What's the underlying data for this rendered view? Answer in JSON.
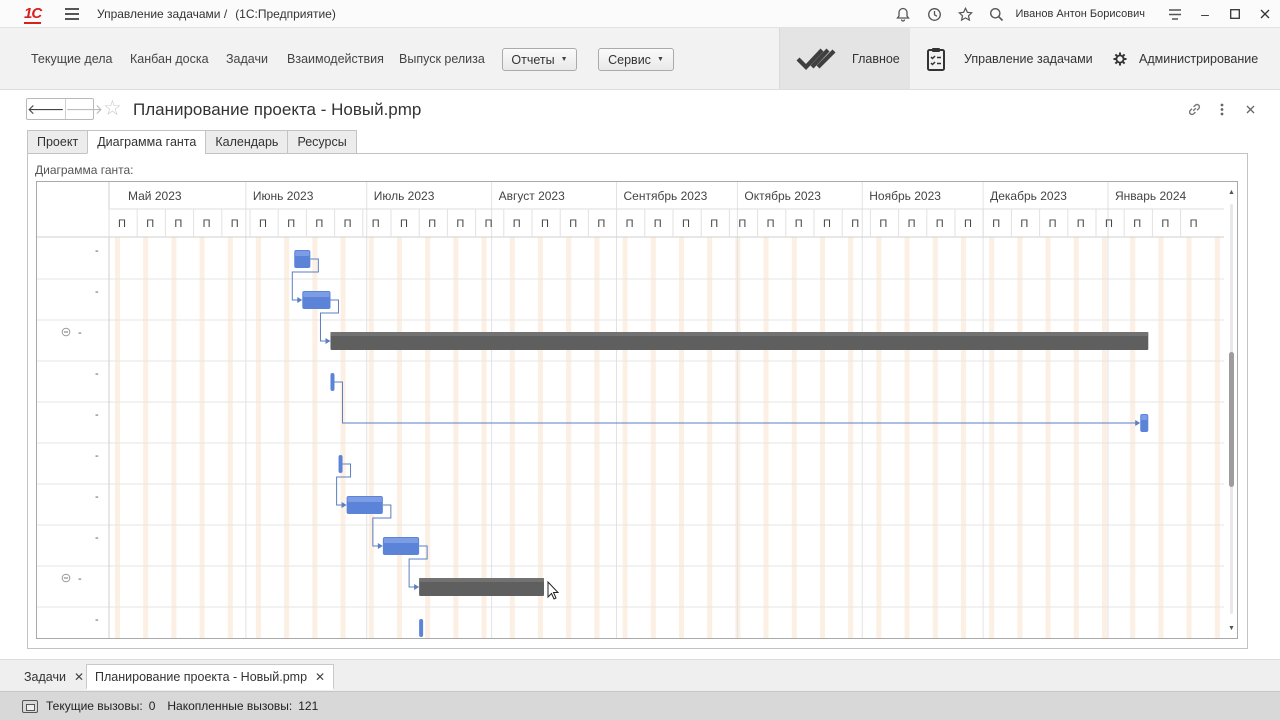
{
  "titlebar": {
    "logo": "1С",
    "app_title": "Управление задачами /",
    "app_platform": "(1С:Предприятие)",
    "user": "Иванов Антон Борисович",
    "icons": [
      "bell-icon",
      "history-icon",
      "star-icon",
      "search-icon",
      "settings-icon",
      "minimize-icon",
      "maximize-icon",
      "close-icon"
    ]
  },
  "nav": {
    "links": [
      "Текущие дела",
      "Канбан доска",
      "Задачи",
      "Взаимодействия",
      "Выпуск релиза"
    ],
    "dropdowns": [
      "Отчеты",
      "Сервис"
    ],
    "sections": [
      "Главное",
      "Управление задачами",
      "Администрирование"
    ]
  },
  "form": {
    "title": "Планирование проекта - Новый.pmp",
    "back": "🡐",
    "forward": "🡒",
    "tools": [
      "link-icon",
      "more-icon",
      "close-icon"
    ]
  },
  "tabs": [
    "Проект",
    "Диаграмма ганта",
    "Календарь",
    "Ресурсы"
  ],
  "active_tab": "Диаграмма ганта",
  "gantt": {
    "label": "Диаграмма ганта:",
    "months": [
      "Май 2023",
      "Июнь 2023",
      "Июль 2023",
      "Август 2023",
      "Сентябрь 2023",
      "Октябрь 2023",
      "Ноябрь 2023",
      "Декабрь 2023",
      "Январь 2024"
    ],
    "week_label": "П",
    "rows": [
      {
        "name": "-",
        "collapsible": false
      },
      {
        "name": "-",
        "collapsible": false
      },
      {
        "name": "-",
        "collapsible": true
      },
      {
        "name": "-",
        "collapsible": false
      },
      {
        "name": "-",
        "collapsible": false
      },
      {
        "name": "-",
        "collapsible": false
      },
      {
        "name": "-",
        "collapsible": false
      },
      {
        "name": "-",
        "collapsible": false
      },
      {
        "name": "-",
        "collapsible": true
      },
      {
        "name": "-",
        "collapsible": false
      }
    ],
    "tasks": [
      {
        "row": 0,
        "start": "2023-06-13",
        "end": "2023-06-17",
        "kind": "task"
      },
      {
        "row": 1,
        "start": "2023-06-15",
        "end": "2023-06-22",
        "kind": "task"
      },
      {
        "row": 2,
        "start": "2023-06-22",
        "end": "2024-01-11",
        "kind": "summary"
      },
      {
        "row": 3,
        "start": "2023-06-22",
        "end": "2023-06-23",
        "kind": "milestone"
      },
      {
        "row": 4,
        "start": "2024-01-09",
        "end": "2024-01-11",
        "kind": "task"
      },
      {
        "row": 5,
        "start": "2023-06-24",
        "end": "2023-06-25",
        "kind": "milestone"
      },
      {
        "row": 6,
        "start": "2023-06-26",
        "end": "2023-07-05",
        "kind": "task"
      },
      {
        "row": 7,
        "start": "2023-07-05",
        "end": "2023-07-14",
        "kind": "task"
      },
      {
        "row": 8,
        "start": "2023-07-14",
        "end": "2023-08-14",
        "kind": "summary"
      },
      {
        "row": 9,
        "start": "2023-07-14",
        "end": "2023-07-15",
        "kind": "milestone"
      }
    ],
    "links": [
      {
        "from": 0,
        "to": 1
      },
      {
        "from": 1,
        "to": 2
      },
      {
        "from": 3,
        "to": 4
      },
      {
        "from": 5,
        "to": 6
      },
      {
        "from": 6,
        "to": 7
      },
      {
        "from": 7,
        "to": 8
      }
    ],
    "colors": {
      "task": "#5b84d9",
      "summary": "#5f5f5f",
      "weekend": "#fcefe4",
      "grid": "#e6e6e6",
      "link": "#5a7fc4"
    }
  },
  "open_windows": [
    "Задачи",
    "Планирование проекта - Новый.pmp"
  ],
  "status": {
    "current_label": "Текущие вызовы:",
    "current_value": "0",
    "total_label": "Накопленные вызовы:",
    "total_value": "121"
  }
}
